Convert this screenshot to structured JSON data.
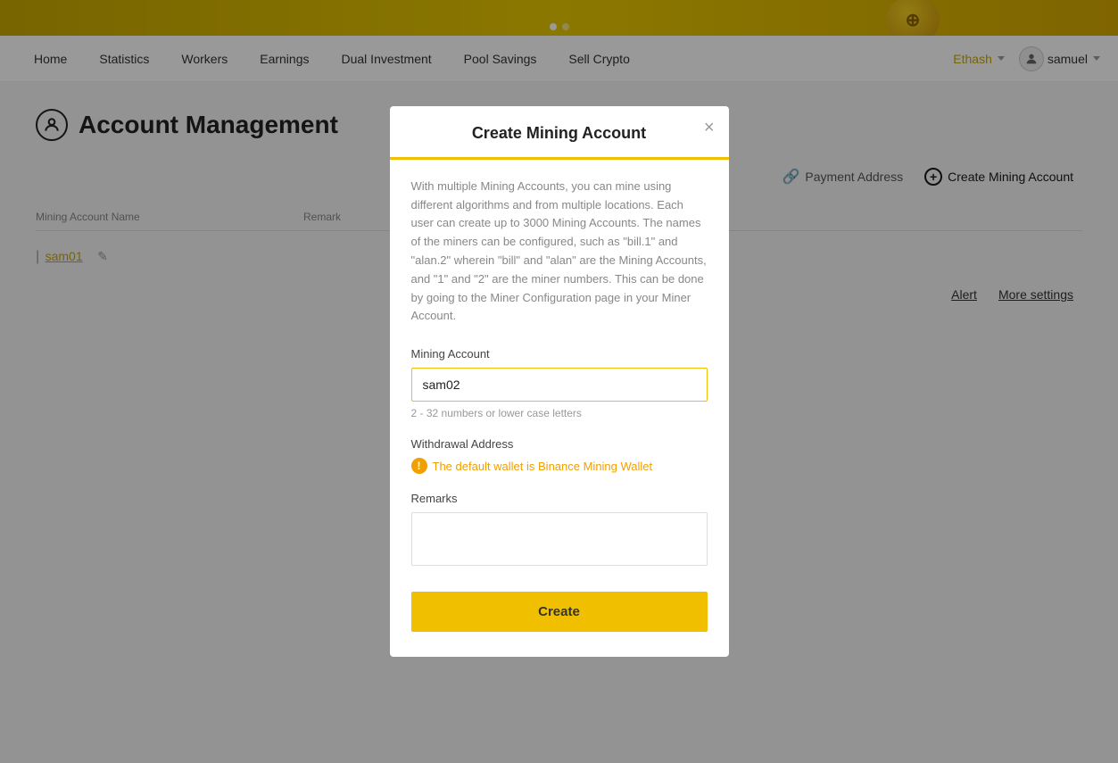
{
  "banner": {
    "dots": [
      {
        "active": true
      },
      {
        "active": false
      }
    ]
  },
  "nav": {
    "items": [
      "Home",
      "Statistics",
      "Workers",
      "Earnings",
      "Dual Investment",
      "Pool Savings",
      "Sell Crypto"
    ],
    "network": "Ethash",
    "user": "samuel"
  },
  "page": {
    "title": "Account Management",
    "actions": {
      "payment_address": "Payment Address",
      "create_mining_account": "Create Mining Account",
      "alert": "Alert",
      "more_settings": "More settings"
    }
  },
  "table": {
    "columns": [
      "Mining Account Name",
      "Remark"
    ],
    "rows": [
      {
        "name": "sam01",
        "remark": ""
      }
    ]
  },
  "modal": {
    "title": "Create Mining Account",
    "description": "With multiple Mining Accounts, you can mine using different algorithms and from multiple locations. Each user can create up to 3000 Mining Accounts. The names of the miners can be configured, such as \"bill.1\" and \"alan.2\" wherein \"bill\" and \"alan\" are the Mining Accounts, and \"1\" and \"2\" are the miner numbers. This can be done by going to the Miner Configuration page in your Miner Account.",
    "mining_account_label": "Mining Account",
    "mining_account_value": "sam02",
    "mining_account_hint": "2 - 32 numbers or lower case letters",
    "withdrawal_label": "Withdrawal Address",
    "withdrawal_warning": "The default wallet is Binance Mining Wallet",
    "remarks_label": "Remarks",
    "create_button": "Create"
  }
}
